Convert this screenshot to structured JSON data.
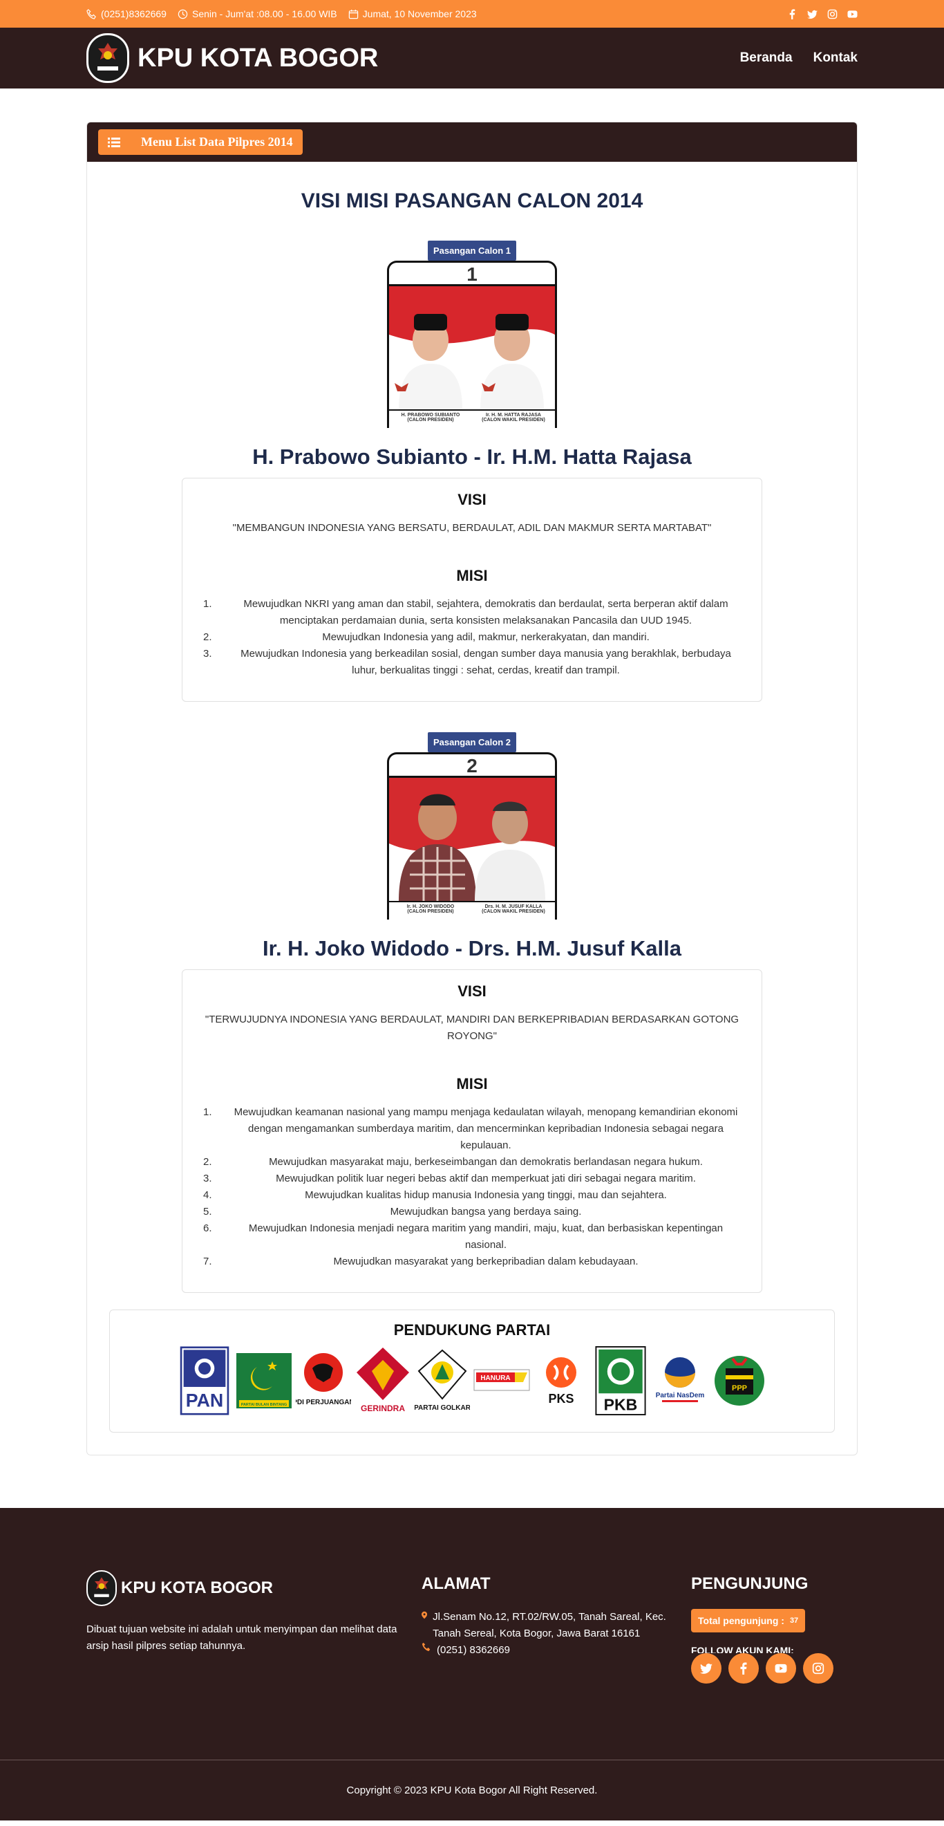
{
  "topbar": {
    "phone": "(0251)8362669",
    "hours": "Senin - Jum'at :08.00 - 16.00 WIB",
    "date": "Jumat, 10 November 2023",
    "socials": [
      "facebook-icon",
      "twitter-icon",
      "instagram-icon",
      "youtube-icon"
    ]
  },
  "navbar": {
    "brand": "KPU KOTA BOGOR",
    "links": [
      "Beranda",
      "Kontak"
    ]
  },
  "panel": {
    "menu_label": "Menu List Data Pilpres 2014",
    "title": "VISI MISI PASANGAN CALON 2014"
  },
  "candidates": [
    {
      "badge": "Pasangan Calon 1",
      "number": "1",
      "ballot_left": "H. PRABOWO SUBIANTO",
      "ballot_left_sub": "(CALON PRESIDEN)",
      "ballot_right": "Ir. H. M. HATTA RAJASA",
      "ballot_right_sub": "(CALON WAKIL PRESIDEN)",
      "name": "H. Prabowo Subianto - Ir. H.M. Hatta Rajasa",
      "visi_label": "VISI",
      "visi": "\"MEMBANGUN INDONESIA YANG BERSATU, BERDAULAT, ADIL DAN MAKMUR SERTA MARTABAT\"",
      "misi_label": "MISI",
      "misi": [
        "Mewujudkan NKRI yang aman dan stabil, sejahtera, demokratis dan berdaulat, serta berperan aktif dalam menciptakan perdamaian dunia, serta konsisten melaksanakan Pancasila dan UUD 1945.",
        "Mewujudkan Indonesia yang adil, makmur, nerkerakyatan, dan mandiri.",
        "Mewujudkan Indonesia yang berkeadilan sosial, dengan sumber daya manusia yang berakhlak, berbudaya luhur, berkualitas tinggi : sehat, cerdas, kreatif dan trampil."
      ]
    },
    {
      "badge": "Pasangan Calon 2",
      "number": "2",
      "ballot_left": "Ir. H. JOKO WIDODO",
      "ballot_left_sub": "(CALON PRESIDEN)",
      "ballot_right": "Drs. H. M. JUSUF KALLA",
      "ballot_right_sub": "(CALON WAKIL PRESIDEN)",
      "name": "Ir. H. Joko Widodo - Drs. H.M. Jusuf Kalla",
      "visi_label": "VISI",
      "visi": "\"TERWUJUDNYA INDONESIA YANG BERDAULAT, MANDIRI DAN BERKEPRIBADIAN BERDASARKAN GOTONG ROYONG\"",
      "misi_label": "MISI",
      "misi": [
        "Mewujudkan keamanan nasional yang mampu menjaga kedaulatan wilayah, menopang kemandirian ekonomi dengan mengamankan sumberdaya maritim, dan mencerminkan kepribadian Indonesia sebagai negara kepulauan.",
        "Mewujudkan masyarakat maju, berkeseimbangan dan demokratis berlandasan negara hukum.",
        "Mewujudkan politik luar negeri bebas aktif dan memperkuat jati diri sebagai negara maritim.",
        "Mewujudkan kualitas hidup manusia Indonesia yang tinggi, mau dan sejahtera.",
        "Mewujudkan bangsa yang berdaya saing.",
        "Mewujudkan Indonesia menjadi negara maritim yang mandiri, maju, kuat, dan berbasiskan kepentingan nasional.",
        "Mewujudkan masyarakat yang berkepribadian dalam kebudayaan."
      ]
    }
  ],
  "support": {
    "title": "PENDUKUNG PARTAI",
    "parties": [
      {
        "label": "PAN",
        "icon": "pan-logo"
      },
      {
        "label": "PARTAI BULAN BINTANG",
        "icon": "pbb-logo"
      },
      {
        "label": "PDI PERJUANGAN",
        "icon": "pdip-logo"
      },
      {
        "label": "GERINDRA",
        "icon": "gerindra-logo"
      },
      {
        "label": "PARTAI GOLKAR",
        "icon": "golkar-logo"
      },
      {
        "label": "HANURA",
        "icon": "hanura-logo"
      },
      {
        "label": "PKS",
        "icon": "pks-logo"
      },
      {
        "label": "PKB",
        "icon": "pkb-logo"
      },
      {
        "label": "Partai NasDem",
        "icon": "nasdem-logo"
      },
      {
        "label": "PPP",
        "icon": "ppp-logo"
      }
    ]
  },
  "footer": {
    "brand": "KPU KOTA BOGOR",
    "desc": "Dibuat tujuan website ini adalah untuk menyimpan dan melihat data arsip hasil pilpres setiap tahunnya.",
    "address_title": "ALAMAT",
    "address": "Jl.Senam No.12, RT.02/RW.05, Tanah Sareal, Kec. Tanah Sereal, Kota Bogor, Jawa Barat 16161",
    "phone": "(0251) 8362669",
    "visitor_title": "PENGUNJUNG",
    "visitor_label": "Total pengunjung :",
    "visitor_count": "37",
    "follow": "FOLLOW AKUN KAMI:",
    "copyright": "Copyright © 2023 KPU Kota Bogor All Right Reserved."
  }
}
